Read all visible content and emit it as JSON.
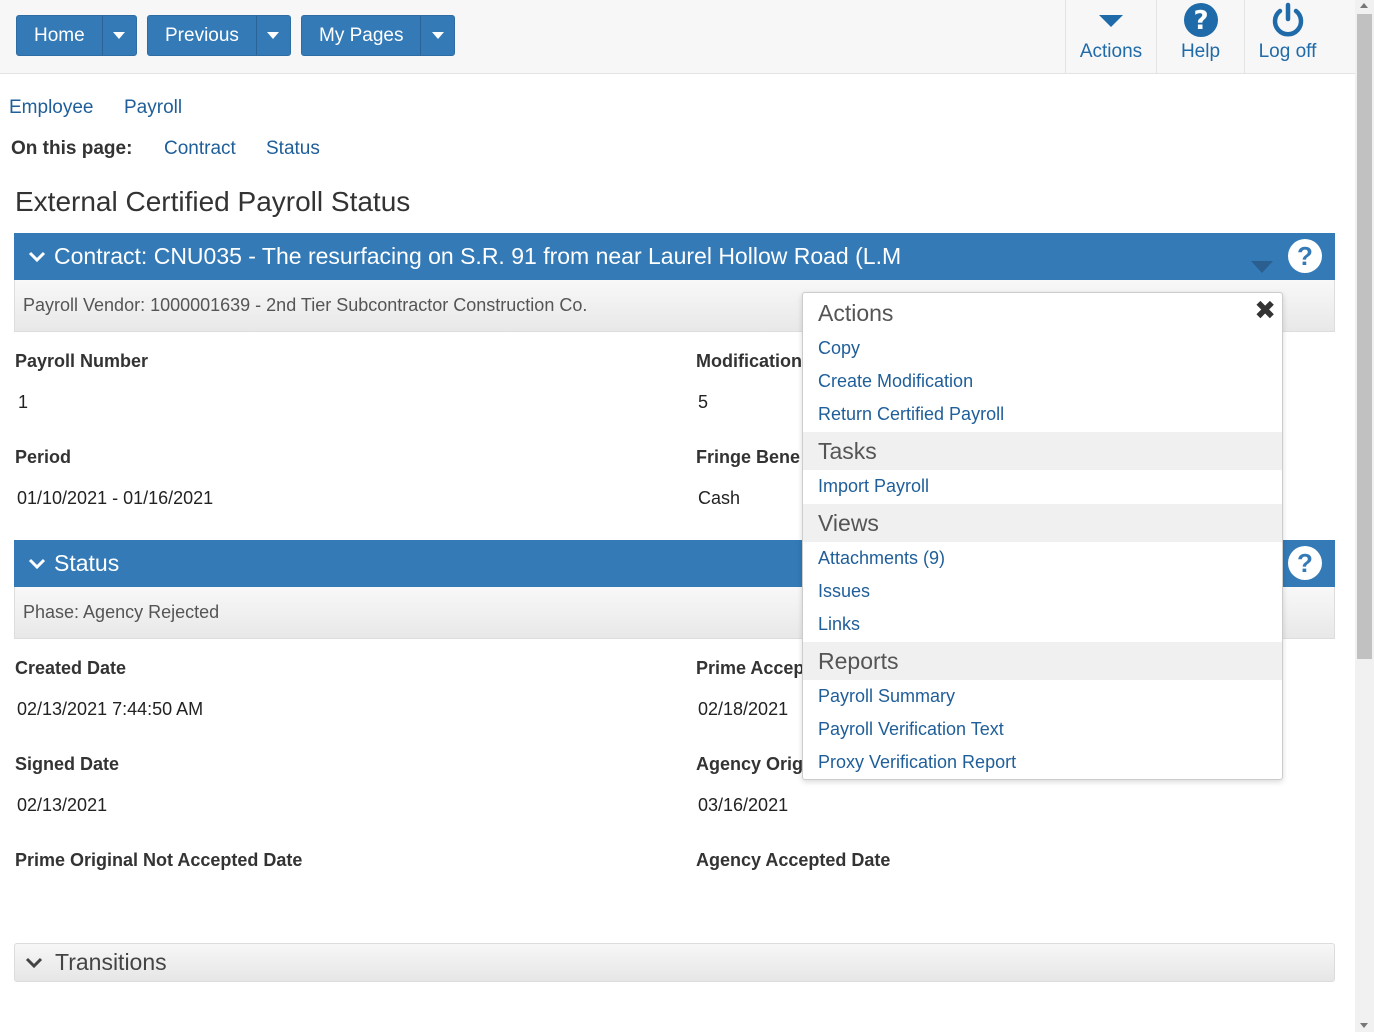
{
  "nav": {
    "home": "Home",
    "previous": "Previous",
    "my_pages": "My Pages"
  },
  "toolbar": {
    "actions": "Actions",
    "help": "Help",
    "logoff": "Log off"
  },
  "breadcrumb": {
    "employee": "Employee",
    "payroll": "Payroll"
  },
  "on_this_page": {
    "label": "On this page:",
    "contract": "Contract",
    "status": "Status"
  },
  "page_title": "External Certified Payroll Status",
  "contract_panel": {
    "title": "Contract: CNU035 - The resurfacing on S.R. 91 from near Laurel Hollow Road (L.M",
    "vendor": "Payroll Vendor: 1000001639 - 2nd Tier Subcontractor Construction Co."
  },
  "fields": {
    "payroll_number_label": "Payroll Number",
    "payroll_number_value": "1",
    "modification_label": "Modification",
    "modification_value": "5",
    "period_label": "Period",
    "period_value": "01/10/2021 - 01/16/2021",
    "fringe_label": "Fringe Bene",
    "fringe_value": "Cash"
  },
  "status_panel": {
    "title": "Status",
    "phase": "Phase: Agency Rejected"
  },
  "status_fields": {
    "created_label": "Created Date",
    "created_value": "02/13/2021 7:44:50 AM",
    "prime_accepted_label": "Prime Accep",
    "prime_accepted_value": "02/18/2021",
    "signed_label": "Signed Date",
    "signed_value": "02/13/2021",
    "agency_original_label": "Agency Orig",
    "agency_original_value": "03/16/2021",
    "prime_not_accepted_label": "Prime Original Not Accepted Date",
    "agency_accepted_label": "Agency Accepted Date"
  },
  "transitions": "Transitions",
  "popover": {
    "actions_header": "Actions",
    "copy": "Copy",
    "create_modification": "Create Modification",
    "return_certified": "Return Certified Payroll",
    "tasks_header": "Tasks",
    "import_payroll": "Import Payroll",
    "views_header": "Views",
    "attachments": "Attachments (9)",
    "issues": "Issues",
    "links": "Links",
    "reports_header": "Reports",
    "payroll_summary": "Payroll Summary",
    "payroll_verification": "Payroll Verification Text",
    "proxy_verification": "Proxy Verification Report",
    "close": "✖"
  },
  "colors": {
    "primary": "#337ab7",
    "link": "#1f5e99"
  }
}
